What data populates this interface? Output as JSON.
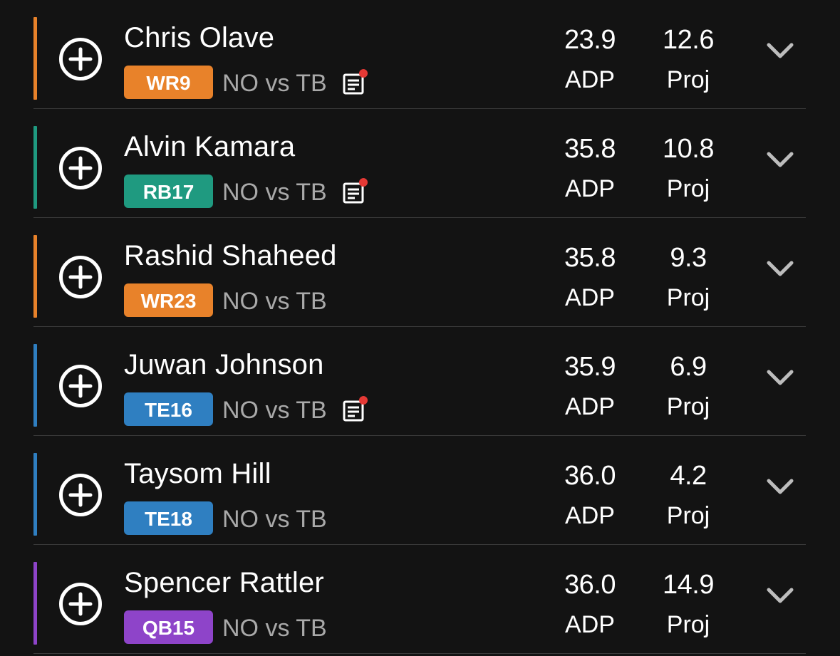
{
  "colors": {
    "background": "#131313",
    "WR": "#e8822a",
    "RB": "#1f9a80",
    "TE": "#2f7fc1",
    "QB": "#8e44c9",
    "note_dot": "#e53935",
    "divider": "#3a3a3a"
  },
  "icons": {
    "add": "plus-circle-icon",
    "notes": "news-note-icon",
    "expand": "chevron-down-icon"
  },
  "players": [
    {
      "name": "Chris Olave",
      "position": "WR9",
      "position_group": "WR",
      "matchup": "NO vs TB",
      "has_note": true,
      "adp": "23.9",
      "adp_label": "ADP",
      "proj": "12.6",
      "proj_label": "Proj"
    },
    {
      "name": "Alvin Kamara",
      "position": "RB17",
      "position_group": "RB",
      "matchup": "NO vs TB",
      "has_note": true,
      "adp": "35.8",
      "adp_label": "ADP",
      "proj": "10.8",
      "proj_label": "Proj"
    },
    {
      "name": "Rashid Shaheed",
      "position": "WR23",
      "position_group": "WR",
      "matchup": "NO vs TB",
      "has_note": false,
      "adp": "35.8",
      "adp_label": "ADP",
      "proj": "9.3",
      "proj_label": "Proj"
    },
    {
      "name": "Juwan Johnson",
      "position": "TE16",
      "position_group": "TE",
      "matchup": "NO vs TB",
      "has_note": true,
      "adp": "35.9",
      "adp_label": "ADP",
      "proj": "6.9",
      "proj_label": "Proj"
    },
    {
      "name": "Taysom Hill",
      "position": "TE18",
      "position_group": "TE",
      "matchup": "NO vs TB",
      "has_note": false,
      "adp": "36.0",
      "adp_label": "ADP",
      "proj": "4.2",
      "proj_label": "Proj"
    },
    {
      "name": "Spencer Rattler",
      "position": "QB15",
      "position_group": "QB",
      "matchup": "NO vs TB",
      "has_note": false,
      "adp": "36.0",
      "adp_label": "ADP",
      "proj": "14.9",
      "proj_label": "Proj"
    }
  ]
}
